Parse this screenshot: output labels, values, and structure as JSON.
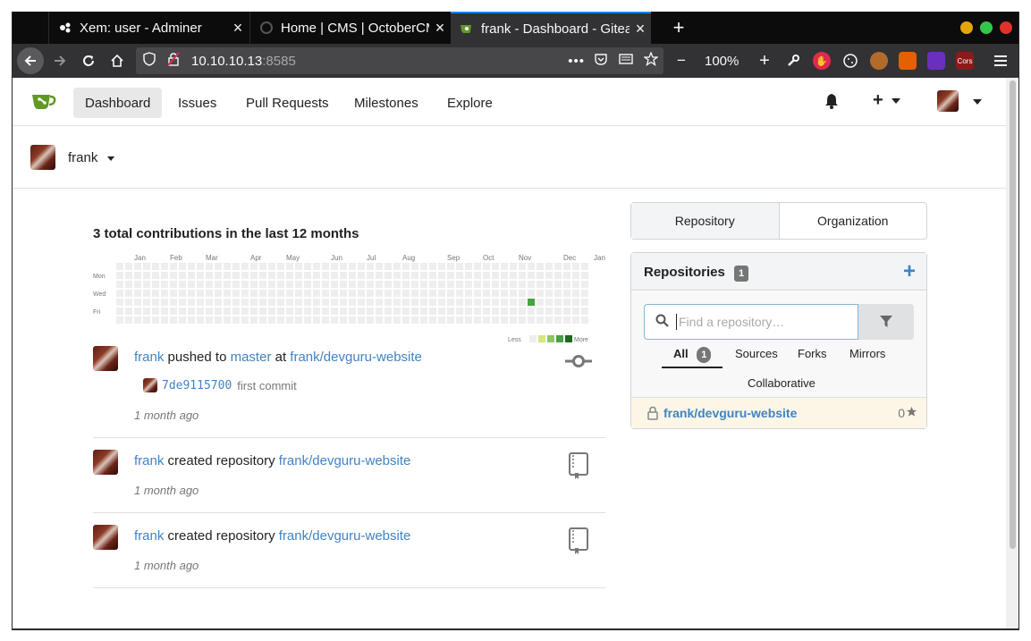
{
  "browser": {
    "tabs": [
      {
        "title": "Xem: user - Adminer",
        "icon": "adminer-icon",
        "active": false
      },
      {
        "title": "Home | CMS | OctoberCMS",
        "icon": "octobercms-icon",
        "active": false
      },
      {
        "title": "frank - Dashboard - Gitea",
        "icon": "gitea-icon",
        "active": true
      }
    ],
    "new_tab": "+",
    "url_host": "10.10.10.13",
    "url_port": ":8585",
    "url_more": "•••",
    "zoom": "100%",
    "zoom_minus": "−",
    "zoom_plus": "+"
  },
  "nav": {
    "items": [
      "Dashboard",
      "Issues",
      "Pull Requests",
      "Milestones",
      "Explore"
    ],
    "active": "Dashboard",
    "plus": "+"
  },
  "user": {
    "name": "frank"
  },
  "contributions": {
    "title": "3 total contributions in the last 12 months",
    "months": [
      "Jan",
      "Feb",
      "Mar",
      "Apr",
      "May",
      "Jun",
      "Jul",
      "Aug",
      "Sep",
      "Oct",
      "Nov",
      "Dec",
      "Jan"
    ],
    "days": [
      "Mon",
      "Wed",
      "Fri"
    ],
    "less": "Less",
    "more": "More",
    "legend_colors": [
      "#eeeeee",
      "#d6e685",
      "#8cc665",
      "#44a340",
      "#1e6823"
    ],
    "active_cells": [
      {
        "week": 46,
        "day": 4,
        "level": 3
      }
    ]
  },
  "feed": [
    {
      "actor": "frank",
      "action": "pushed to",
      "branch": "master",
      "at": "at",
      "repo": "frank/devguru-website",
      "commit_sha": "7de9115700",
      "commit_msg": "first commit",
      "time": "1 month ago",
      "icon": "git-commit-icon"
    },
    {
      "actor": "frank",
      "action": "created repository",
      "repo": "frank/devguru-website",
      "time": "1 month ago",
      "icon": "repo-book-icon"
    },
    {
      "actor": "frank",
      "action": "created repository",
      "repo": "frank/devguru-website",
      "time": "1 month ago",
      "icon": "repo-book-icon"
    }
  ],
  "sidebar": {
    "tabs": [
      "Repository",
      "Organization"
    ],
    "repositories_title": "Repositories",
    "repositories_count": "1",
    "add_button": "+",
    "search_placeholder": "Find a repository…",
    "filter_tabs": [
      {
        "label": "All",
        "count": "1"
      },
      {
        "label": "Sources"
      },
      {
        "label": "Forks"
      },
      {
        "label": "Mirrors"
      },
      {
        "label": "Collaborative"
      }
    ],
    "repo_item": {
      "name": "frank/devguru-website",
      "stars": "0"
    }
  }
}
